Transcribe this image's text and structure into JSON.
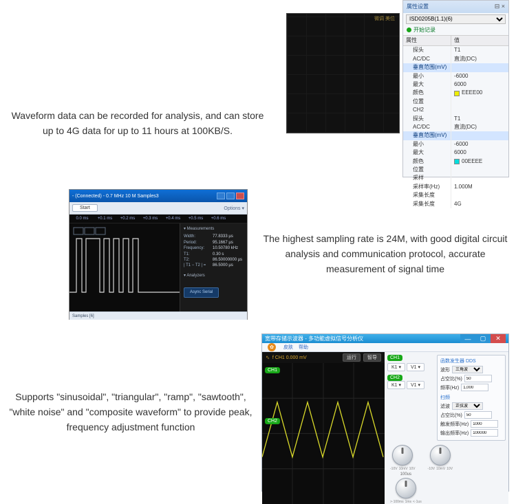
{
  "section1": {
    "caption": "Waveform data can be recorded for analysis, and can store up to 4G data for up to 11 hours at 100KB/S.",
    "panel": {
      "scope_tag": "微调\n美位",
      "title": "属性设置",
      "device_select": "ISD0205B(1.1)(6)",
      "record_btn": "开始记录",
      "col_name": "属性",
      "col_val": "值",
      "rows": [
        {
          "k": "探头",
          "v": "T1"
        },
        {
          "k": "AC/DC",
          "v": "直流(DC)"
        },
        {
          "k": "垂直范围(mV)",
          "v": "",
          "sel": true
        },
        {
          "k": "最小",
          "v": "-6000"
        },
        {
          "k": "最大",
          "v": "6000"
        },
        {
          "k": "颜色",
          "v": "EEEE00",
          "sw": "sw-yellow"
        },
        {
          "k": "位置",
          "v": ""
        },
        {
          "k": "CH2",
          "v": ""
        },
        {
          "k": "探头",
          "v": "T1"
        },
        {
          "k": "AC/DC",
          "v": "直流(DC)"
        },
        {
          "k": "垂直范围(mV)",
          "v": "",
          "sel": true
        },
        {
          "k": "最小",
          "v": "-6000"
        },
        {
          "k": "最大",
          "v": "6000"
        },
        {
          "k": "颜色",
          "v": "00EEEE",
          "sw": "sw-cyan"
        },
        {
          "k": "位置",
          "v": ""
        },
        {
          "k": "采样",
          "v": ""
        },
        {
          "k": "采样率(Hz)",
          "v": "1.000M"
        },
        {
          "k": "采集长度",
          "v": ""
        },
        {
          "k": "采集长度",
          "v": "4G"
        }
      ]
    }
  },
  "section2": {
    "caption": "The highest sampling rate is 24M, with good digital circuit analysis and communication protocol, accurate measurement of signal time",
    "app": {
      "title": " - (Connected) - 0.7 MHz  10 M Samples3",
      "start": "Start",
      "options": "Options ▾",
      "axis": [
        "0.0 ms",
        "+0.1 ms",
        "+0.2 ms",
        "+0.3 ms",
        "+0.4 ms",
        "+0.5 ms",
        "+0.6 ms"
      ],
      "measurements_hdr": "▾ Measurements",
      "measurements": [
        {
          "k": "Width:",
          "v": "77.8333 µs"
        },
        {
          "k": "Period:",
          "v": "95.1667 µs"
        },
        {
          "k": "Frequency:",
          "v": "10.50780 kHz"
        },
        {
          "k": "T1:",
          "v": "0.30 s"
        },
        {
          "k": "T2:",
          "v": "86.50000000 µs"
        },
        {
          "k": "| T1 − T2 | =",
          "v": "86.5000 µs"
        }
      ],
      "analyzers_hdr": "▾ Analyzers",
      "serial_btn": "Async Serial",
      "status": "Samples [6]"
    }
  },
  "section3": {
    "caption": "Supports \"sinusoidal\", \"triangular\", \"ramp\", \"sawtooth\", \"white noise\" and \"composite waveform\" to provide peak, frequency adjustment function",
    "app": {
      "title": "宽带存储示波器 - 多功能虚拟信号分析仪",
      "menu": [
        "皮肤",
        "帮助"
      ],
      "readout": "f  CH1 0.000 mV",
      "pills": [
        "运行",
        "智导"
      ],
      "ch_badges": [
        "CH1",
        "CH2"
      ],
      "gen_title": "函数发生器 DDS",
      "wave_label": "波形",
      "wave_value": "三角波",
      "duty_label": "占空比(%)",
      "duty_value": "50",
      "freq_label": "频率(Hz)",
      "freq_value": "1,000",
      "sweep_title": "扫频",
      "filter_label": "滤波",
      "filter_value": "正弦波",
      "sw_duty_label": "占空比(%)",
      "sw_duty_value": "50",
      "sw_freq_label": "触发频率(Hz)",
      "sw_freq_value": "1000",
      "sw_out_label": "输出频率(Hz)",
      "sw_out_value": "100000",
      "dial_set1": {
        "ticks": [
          "K1",
          "V1"
        ],
        "vals": [
          "10mV",
          "…",
          "-1OV",
          "",
          "1OV"
        ]
      },
      "dial_set2": {
        "center": "100us",
        "sides": [
          ">·100ms",
          "<·1us"
        ],
        "bottom": [
          "1ms",
          "0"
        ]
      }
    }
  }
}
